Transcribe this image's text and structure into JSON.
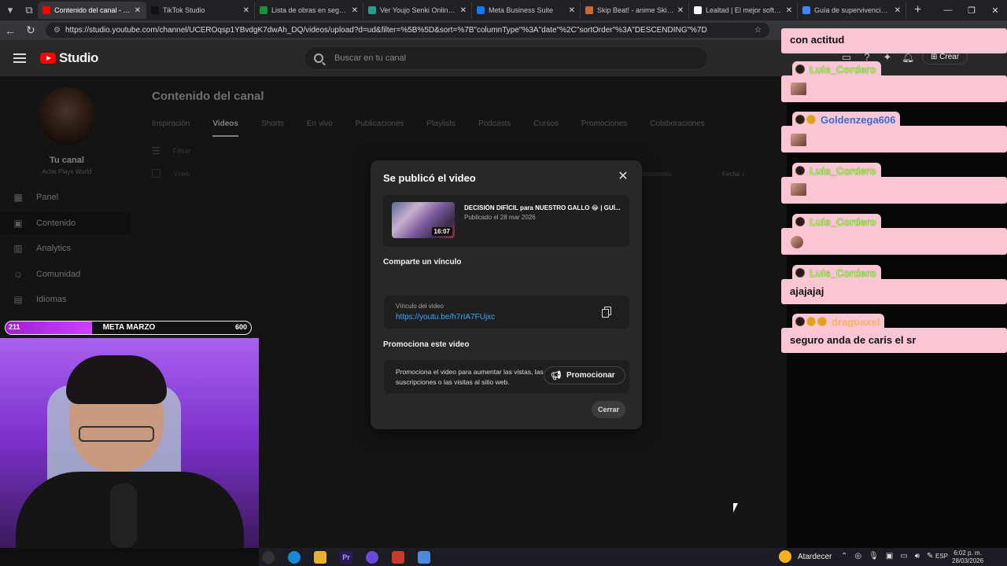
{
  "browser": {
    "tabs": [
      {
        "label": "Contenido del canal - YouTube",
        "color": "#ff0000",
        "active": true
      },
      {
        "label": "TikTok Studio",
        "color": "#111111",
        "active": false
      },
      {
        "label": "Lista de obras en seguimiento",
        "color": "#1e8e3e",
        "active": false
      },
      {
        "label": "Ver Youjo Senki Online Sub",
        "color": "#2a9d8f",
        "active": false
      },
      {
        "label": "Meta Business Suite",
        "color": "#1877f2",
        "active": false
      },
      {
        "label": "Skip Beat! - anime Skip Beat",
        "color": "#cc6633",
        "active": false
      },
      {
        "label": "Lealtad | El mejor software",
        "color": "#ffffff",
        "active": false
      },
      {
        "label": "Guía de supervivencia del e",
        "color": "#4285f4",
        "active": false
      }
    ],
    "url": "https://studio.youtube.com/channel/UCEROqsp1YBvdgK7dwAh_DQ/videos/upload?d=ud&filter=%5B%5D&sort=%7B\"columnType\"%3A\"date\"%2C\"sortOrder\"%3A\"DESCENDING\"%7D"
  },
  "studio": {
    "logo_text": "Studio",
    "search_placeholder": "Buscar en tu canal",
    "create_label": "Crear"
  },
  "sidebar": {
    "channel_title": "Tu canal",
    "channel_name": "Ache Plays World",
    "items": [
      {
        "label": "Panel",
        "icon": "dashboard-icon",
        "selected": false
      },
      {
        "label": "Contenido",
        "icon": "content-icon",
        "selected": true
      },
      {
        "label": "Analytics",
        "icon": "analytics-icon",
        "selected": false
      },
      {
        "label": "Comunidad",
        "icon": "community-icon",
        "selected": false
      },
      {
        "label": "Idiomas",
        "icon": "languages-icon",
        "selected": false
      }
    ]
  },
  "main": {
    "title": "Contenido del canal",
    "tabs": [
      "Inspiración",
      "Videos",
      "Shorts",
      "En vivo",
      "Publicaciones",
      "Playlists",
      "Podcasts",
      "Cursos",
      "Promociones",
      "Colaboraciones"
    ],
    "active_tab": "Videos",
    "filter_label": "Filtrar",
    "col_video": "Video",
    "col_restrictions": "Restricciones",
    "col_date": "Fecha ↓"
  },
  "modal": {
    "title": "Se publicó el video",
    "video_title": "DECISIÓN DIFÍCIL para NUESTRO GALLO 😂 | GUÍ...",
    "video_published": "Publicado el 28 mar 2026",
    "video_duration": "16:07",
    "share_heading": "Comparte un vínculo",
    "link_label": "Vínculo del video",
    "link_url": "https://youtu.be/h7rIA7FUjxc",
    "promo_heading": "Promociona este video",
    "promo_text": "Promociona el video para aumentar las vistas, las suscripciones o las visitas al sitio web.",
    "promo_button": "Promocionar",
    "close_button": "Cerrar"
  },
  "chat": {
    "messages": [
      {
        "user": "",
        "text": "con actitud"
      },
      {
        "user": "Luis_Cordero",
        "text": ""
      },
      {
        "user": "Goldenzega606",
        "text": ""
      },
      {
        "user": "Luis_Cordero",
        "text": ""
      },
      {
        "user": "Luis_Cordero",
        "text": ""
      },
      {
        "user": "Luis_Cordero",
        "text": "ajajajaj"
      },
      {
        "user": "dragoaxel",
        "text": "seguro anda de caris el sr"
      }
    ]
  },
  "goal": {
    "current": "211",
    "name": "META MARZO",
    "max": "600",
    "fraction": 0.352
  },
  "taskbar": {
    "weather": "Atardecer",
    "lang": "ESP",
    "time": "6:02 p. m.",
    "date": "28/03/2026"
  }
}
